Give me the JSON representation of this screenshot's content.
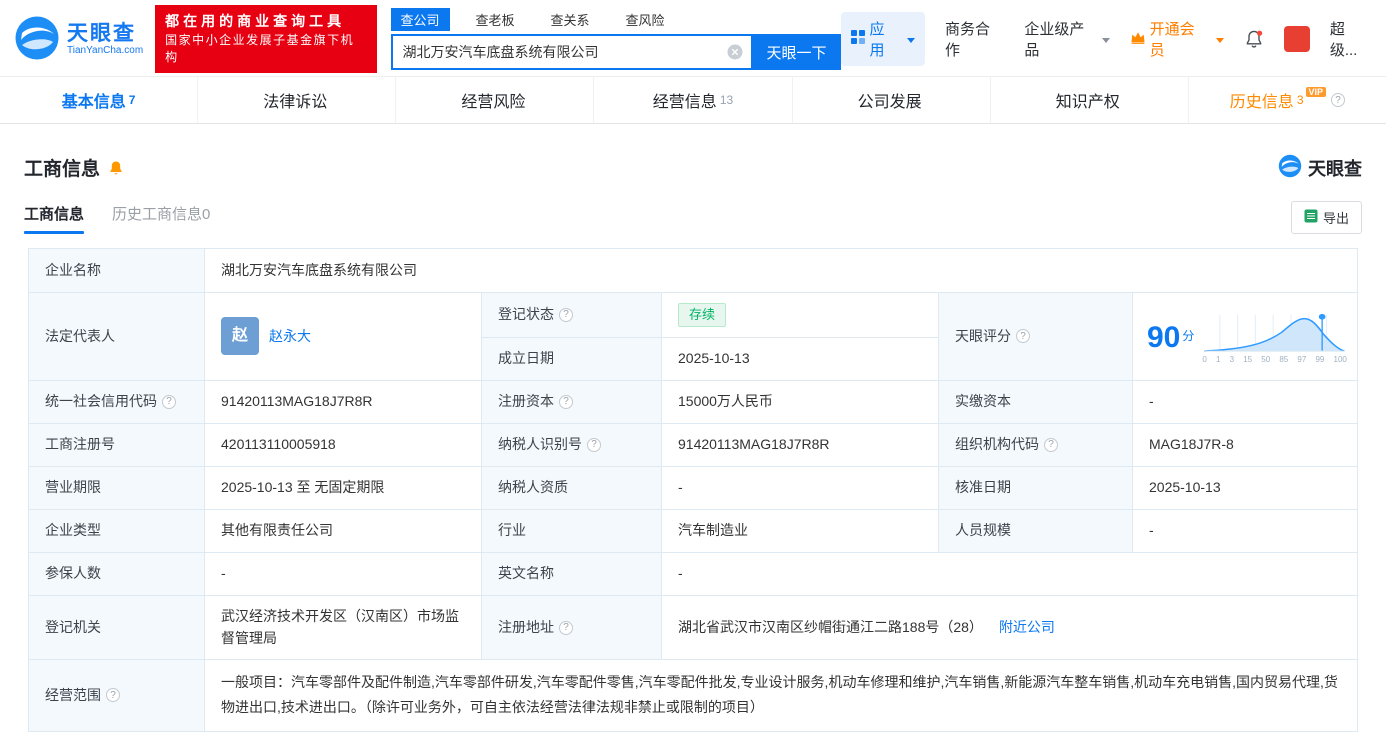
{
  "brand": {
    "logo_text": "天眼查",
    "logo_domain": "TianYanCha.com",
    "slogan_line1": "都在用的商业查询工具",
    "slogan_line2": "国家中小企业发展子基金旗下机构"
  },
  "search": {
    "tabs": [
      {
        "label": "查公司"
      },
      {
        "label": "查老板"
      },
      {
        "label": "查关系"
      },
      {
        "label": "查风险"
      }
    ],
    "value": "湖北万安汽车底盘系统有限公司",
    "button_label": "天眼一下"
  },
  "header_right": {
    "app_label": "应用",
    "biz_coop": "商务合作",
    "enterprise_product": "企业级产品",
    "vip_label": "开通会员",
    "username": "超级..."
  },
  "nav_tabs": [
    {
      "label": "基本信息",
      "count": "7"
    },
    {
      "label": "法律诉讼",
      "count": ""
    },
    {
      "label": "经营风险",
      "count": ""
    },
    {
      "label": "经营信息",
      "count": "13"
    },
    {
      "label": "公司发展",
      "count": ""
    },
    {
      "label": "知识产权",
      "count": ""
    },
    {
      "label": "历史信息",
      "count": "3",
      "vip": "VIP"
    }
  ],
  "section": {
    "title": "工商信息",
    "watermark": "天眼查",
    "subtab_active": "工商信息",
    "subtab_history": "历史工商信息0",
    "export_label": "导出"
  },
  "fields": {
    "company_name_label": "企业名称",
    "company_name": "湖北万安汽车底盘系统有限公司",
    "legal_rep_label": "法定代表人",
    "legal_rep_avatar_char": "赵",
    "legal_rep_name": "赵永大",
    "reg_status_label": "登记状态",
    "reg_status_value": "存续",
    "establish_date_label": "成立日期",
    "establish_date_value": "2025-10-13",
    "score_label": "天眼评分",
    "score_value": "90",
    "score_unit": "分",
    "credit_code_label": "统一社会信用代码",
    "credit_code_value": "91420113MAG18J7R8R",
    "reg_capital_label": "注册资本",
    "reg_capital_value": "15000万人民币",
    "paid_capital_label": "实缴资本",
    "paid_capital_value": "-",
    "reg_number_label": "工商注册号",
    "reg_number_value": "420113110005918",
    "taxpayer_id_label": "纳税人识别号",
    "taxpayer_id_value": "91420113MAG18J7R8R",
    "org_code_label": "组织机构代码",
    "org_code_value": "MAG18J7R-8",
    "business_term_label": "营业期限",
    "business_term_value": "2025-10-13 至 无固定期限",
    "taxpayer_quality_label": "纳税人资质",
    "taxpayer_quality_value": "-",
    "approval_date_label": "核准日期",
    "approval_date_value": "2025-10-13",
    "company_type_label": "企业类型",
    "company_type_value": "其他有限责任公司",
    "industry_label": "行业",
    "industry_value": "汽车制造业",
    "staff_size_label": "人员规模",
    "staff_size_value": "-",
    "insured_count_label": "参保人数",
    "insured_count_value": "-",
    "english_name_label": "英文名称",
    "english_name_value": "-",
    "reg_authority_label": "登记机关",
    "reg_authority_value": "武汉经济技术开发区（汉南区）市场监督管理局",
    "reg_address_label": "注册地址",
    "reg_address_value": "湖北省武汉市汉南区纱帽街通江二路188号（28）",
    "nearby_link": "附近公司",
    "business_scope_label": "经营范围",
    "business_scope_value": "一般项目：汽车零部件及配件制造,汽车零部件研发,汽车零配件零售,汽车零配件批发,专业设计服务,机动车修理和维护,汽车销售,新能源汽车整车销售,机动车充电销售,国内贸易代理,货物进出口,技术进出口。（除许可业务外，可自主依法经营法律法规非禁止或限制的项目）"
  },
  "score_chart": {
    "type": "area",
    "ticks": [
      "0",
      "1",
      "3",
      "15",
      "50",
      "85",
      "97",
      "99",
      "100"
    ],
    "score": 90
  },
  "ui": {
    "question_mark": "?"
  },
  "colors": {
    "brand_blue": "#0b78f0",
    "vip_orange": "#ff8a00",
    "status_green": "#00b365",
    "slogan_red": "#e60012"
  }
}
